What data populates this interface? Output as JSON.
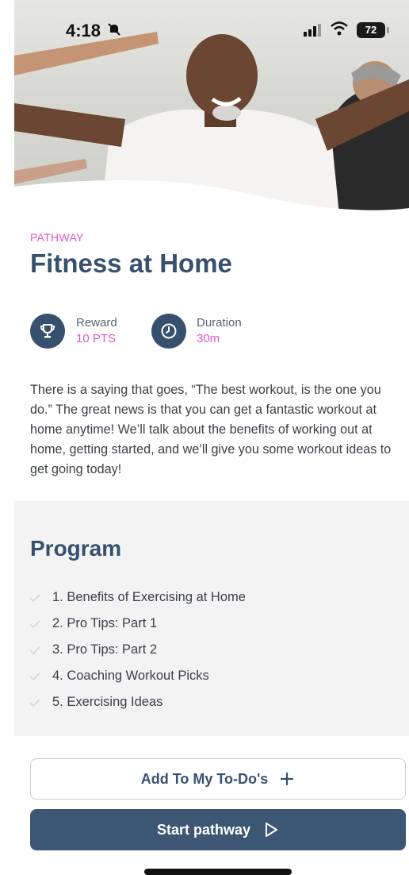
{
  "status_bar": {
    "time": "4:18",
    "battery": "72"
  },
  "pathway": {
    "section_label": "PATHWAY",
    "title": "Fitness at Home",
    "reward": {
      "label": "Reward",
      "value": "10 PTS"
    },
    "duration": {
      "label": "Duration",
      "value": "30m"
    },
    "description": "There is a saying that goes, “The best workout, is the one you do.” The great news is that you can get a fantastic workout at home anytime! We’ll talk about the benefits of working out at home, getting started, and we’ll give you some workout ideas to get going today!"
  },
  "program": {
    "title": "Program",
    "items": [
      {
        "label": "1. Benefits of Exercising at Home"
      },
      {
        "label": "2. Pro Tips: Part 1"
      },
      {
        "label": "3. Pro Tips: Part 2"
      },
      {
        "label": "4. Coaching Workout Picks"
      },
      {
        "label": "5. Exercising Ideas"
      }
    ]
  },
  "actions": {
    "add_todo_label": "Add To My To-Do's",
    "start_label": "Start pathway"
  },
  "colors": {
    "accent": "#e056c6",
    "primary": "#36506e",
    "button": "#3c5674"
  },
  "icons": {
    "reward": "trophy-icon",
    "duration": "clock-icon",
    "add": "plus-icon",
    "start": "play-icon",
    "check": "check-icon"
  }
}
